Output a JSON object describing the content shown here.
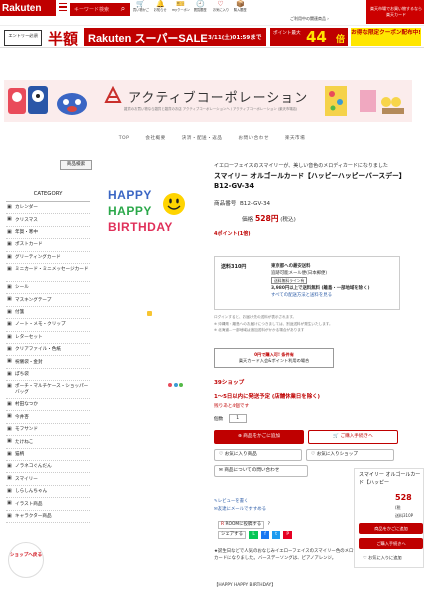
{
  "header": {
    "logo": "Rakuten",
    "search_placeholder": "キーワード検索",
    "icons": [
      {
        "label": "買い物かご",
        "glyph": "🛒"
      },
      {
        "label": "お知らせ",
        "glyph": "🔔"
      },
      {
        "label": "myクーポン",
        "glyph": "🎫"
      },
      {
        "label": "閲覧履歴",
        "glyph": "🕘"
      },
      {
        "label": "お気に入り",
        "glyph": "♡"
      },
      {
        "label": "購入履歴",
        "glyph": "📦"
      }
    ],
    "genre_link": "ご利用中の関連商品 ›",
    "promo": "楽天市場でお買い物するなら楽天カード"
  },
  "campaign": {
    "entry": "エントリー必須",
    "hangaku": "半額",
    "sale_title": "Rakuten スーパーSALE",
    "sale_date": "3/11(土)01:59まで",
    "point_label": "ポイント最大",
    "point_num": "44",
    "point_unit": "倍",
    "coupon": "お得な限定クーポン配布中!"
  },
  "shop": {
    "name": "アクティブコーポレーション",
    "sub": "雑貨のお買い物なら雑貨と雑貨のお店 アクティブコーポレーションへ / アクティブコーポレーション (楽天市場店)",
    "nav": [
      "TOP",
      "会社概要",
      "決済・配送・返品",
      "お問い合わせ",
      "楽天市場"
    ]
  },
  "sidebar": {
    "search_tab": "商品検索",
    "heading": "CATEGORY",
    "items": [
      "カレンダー",
      "クリスマス",
      "年賀・寒中",
      "ポストカード",
      "グリーティングカード",
      "ミニカード・ミニメッセージカード",
      "シール",
      "マスキングテープ",
      "付箋",
      "ノート・メモ・クリップ",
      "レターセット",
      "クリアファイル・色紙",
      "祝儀袋・金封",
      "ぽち袋",
      "ポーチ・マルチケース・ショッパーバッグ",
      "村田なつか",
      "今井杏",
      "モフサンド",
      "たけねこ",
      "猫柄",
      "ノラネコぐんだん",
      "スマイリー",
      "しらしんちゃん",
      "イラスト商品",
      "キャラクター商品"
    ],
    "bubble": "ショップへ戻る"
  },
  "product": {
    "image_text": [
      "HAPPY",
      "HAPPY",
      "BIRTHDAY"
    ],
    "catch": "イエローフェイスのスマイリーが、美しい音色のメロディカードになりました",
    "title": "スマイリー オルゴールカード【ハッピーハッピーバースデー】B12-GV-34",
    "code_label": "商品番号",
    "code": "B12-GV-34",
    "price_label": "価格",
    "price": "528円",
    "tax": "(税込)",
    "points": "4ポイント(1倍)",
    "shipping_left": "送料310円",
    "shipping_lines": [
      "東京都への最安送料",
      "追跡可能メール便(日本郵便)"
    ],
    "shipping_tag": "送料無料ライン有",
    "shipping_free": "3,980円以上で送料無料 (離島・一部地域を除く)",
    "shipping_link": "すべての配送方法と送料を見る",
    "notes": [
      "ログインすると、お届け先の送料が表示されます。",
      "※ 沖縄県・離島へのお届けにつきましては、別途送料が発生いたします。",
      "※ 北海道…一部地域は追加送料がかかる場合があります"
    ],
    "free_box": [
      "0円で購入可! 条件有",
      "楽天カード入会&ポイント利用の場合"
    ],
    "shop_count": "39ショップ",
    "ship_time": "1〜5日以内に発送予定 (店舗休業日を除く)",
    "stock": "残りあと4個です",
    "qty_label": "個数",
    "qty": "1",
    "add_cart": "商品をかごに追加",
    "buy_now": "ご購入手続きへ",
    "fav_item": "お気に入り商品",
    "fav_shop": "お気に入りショップ",
    "inquiry": "商品についての問い合わせ",
    "review": "レビューを書く",
    "mail_friend": "友達にメールですすめる",
    "room": "ROOMに投稿する",
    "share": "シェアする",
    "desc": "★誕生日などで人気のおなじみイエローフェイスのスマイリー色のメロディカードになりました。バースデーソングは、ピアノアレンジ。",
    "desc2": "【HAPPY HAPPY BIRTHDAY】"
  },
  "mini_cart": {
    "title": "スマイリー オルゴールカード【ハッピー",
    "price": "528",
    "sub": "(税",
    "ship": "送料310P",
    "add_cart": "商品をかごに追加",
    "buy": "ご購入手続きへ",
    "fav": "お気に入りに追加"
  },
  "colors": {
    "brand": "#bf0000",
    "accent_yellow": "#ffe600",
    "banner_bg": "#fbecec"
  }
}
